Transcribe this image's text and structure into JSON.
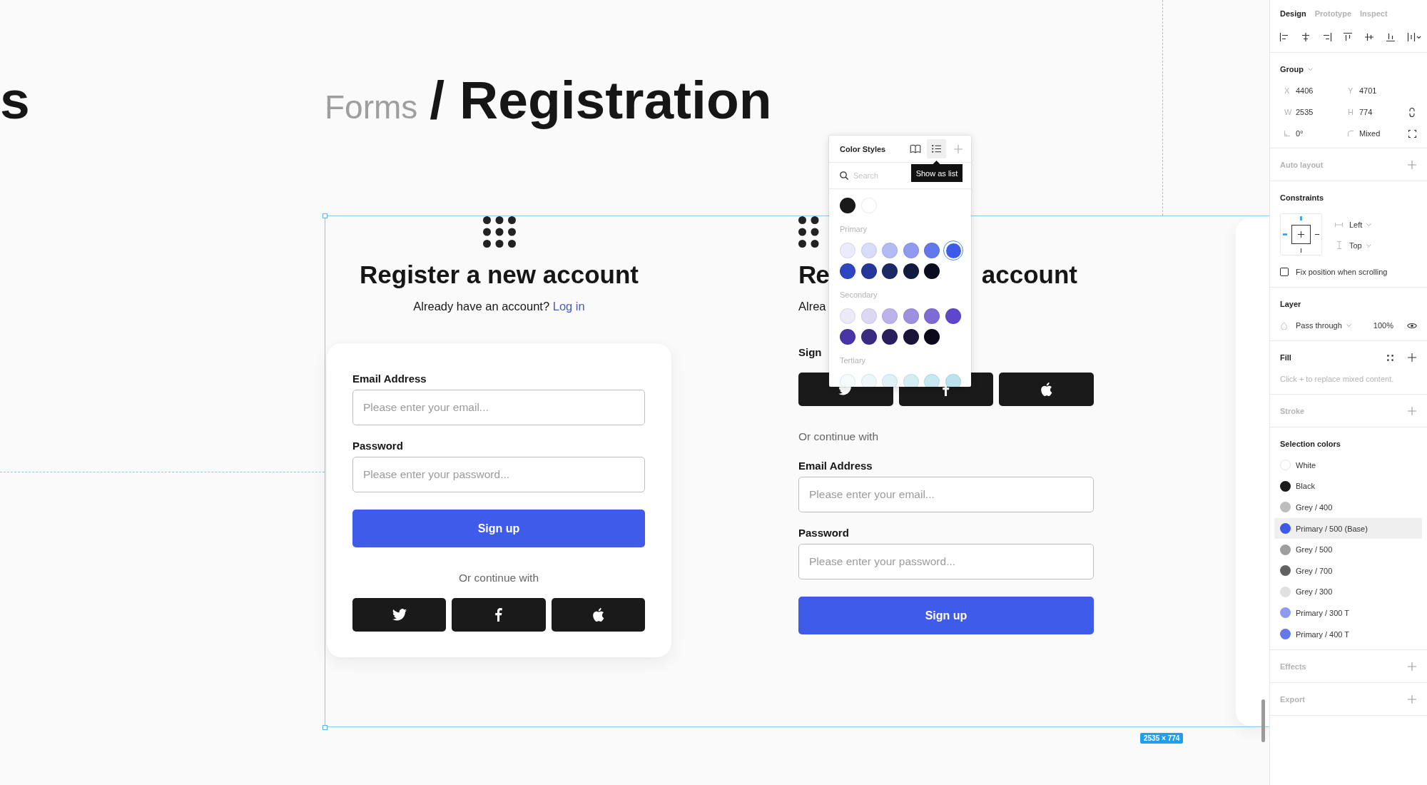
{
  "canvas": {
    "edge_title": "s",
    "breadcrumb": "Forms",
    "title": "/ Registration",
    "frames": [
      {
        "kind": "full",
        "heading": "Register a new account",
        "prompt": "Already have an account?",
        "link": "Log in",
        "fields": [
          {
            "label": "Email Address",
            "placeholder": "Please enter your email..."
          },
          {
            "label": "Password",
            "placeholder": "Please enter your password..."
          }
        ],
        "submit": "Sign up",
        "continue_text": "Or continue with",
        "social": [
          {
            "kind": "twitter"
          },
          {
            "kind": "facebook"
          },
          {
            "kind": "apple"
          }
        ]
      },
      {
        "kind": "covered",
        "heading_start": "Re",
        "heading_end": "account",
        "prompt": "Alrea",
        "social_label": "Sign",
        "social": [
          {
            "kind": "twitter"
          },
          {
            "kind": "facebook"
          },
          {
            "kind": "apple"
          }
        ],
        "continue_text": "Or continue with",
        "fields": [
          {
            "label": "Email Address",
            "placeholder": "Please enter your email..."
          },
          {
            "label": "Password",
            "placeholder": "Please enter your password..."
          }
        ],
        "submit": "Sign up"
      }
    ],
    "size_badge": "2535 × 774"
  },
  "color_styles": {
    "title": "Color Styles",
    "tools": [
      {
        "kind": "book",
        "selected": false
      },
      {
        "kind": "list",
        "selected": true
      },
      {
        "kind": "add",
        "selected": false
      }
    ],
    "tooltip": "Show as list",
    "search_placeholder": "Search",
    "groups": [
      {
        "swatches": [
          {
            "color": "#1a1a1a",
            "selected": false
          },
          {
            "color": "#ffffff",
            "selected": false
          }
        ]
      },
      {
        "label": "Primary",
        "swatches": [
          {
            "color": "#ebebfb",
            "selected": false
          },
          {
            "color": "#d8dcf9",
            "selected": false
          },
          {
            "color": "#b3bbf5",
            "selected": false
          },
          {
            "color": "#8f9bf0",
            "selected": false
          },
          {
            "color": "#6478ec",
            "selected": false
          },
          {
            "color": "#3d5ae8",
            "selected": true
          },
          {
            "color": "#2e46c2",
            "selected": false
          },
          {
            "color": "#253799",
            "selected": false
          },
          {
            "color": "#1b2866",
            "selected": false
          },
          {
            "color": "#121a40",
            "selected": false
          },
          {
            "color": "#0a0d1f",
            "selected": false
          }
        ]
      },
      {
        "label": "Secondary",
        "swatches": [
          {
            "color": "#eceaf8",
            "selected": false
          },
          {
            "color": "#dcd7f3",
            "selected": false
          },
          {
            "color": "#bdb3ea",
            "selected": false
          },
          {
            "color": "#9e8fe0",
            "selected": false
          },
          {
            "color": "#7f6bd6",
            "selected": false
          },
          {
            "color": "#5f47cc",
            "selected": false
          },
          {
            "color": "#4a35a8",
            "selected": false
          },
          {
            "color": "#3b2a82",
            "selected": false
          },
          {
            "color": "#2a1f5b",
            "selected": false
          },
          {
            "color": "#1a1437",
            "selected": false
          },
          {
            "color": "#0b0919",
            "selected": false
          }
        ]
      },
      {
        "label": "Tertiary",
        "swatches": [
          {
            "color": "#f5fbfc",
            "selected": false
          },
          {
            "color": "#edf7f9",
            "selected": false
          },
          {
            "color": "#def1f5",
            "selected": false
          },
          {
            "color": "#d3edf3",
            "selected": false
          },
          {
            "color": "#c7e8f1",
            "selected": false
          },
          {
            "color": "#bae3ee",
            "selected": false
          }
        ]
      }
    ]
  },
  "panel": {
    "tabs": [
      {
        "label": "Design",
        "selected": true
      },
      {
        "label": "Prototype",
        "selected": false
      },
      {
        "label": "Inspect",
        "selected": false
      }
    ],
    "sections": [
      {
        "kind": "properties",
        "title": "Group",
        "rows": [
          [
            {
              "kind": "axis",
              "label": "X",
              "value": "4406"
            },
            {
              "kind": "axis",
              "label": "Y",
              "value": "4701"
            }
          ],
          [
            {
              "kind": "axis",
              "label": "W",
              "value": "2535"
            },
            {
              "kind": "axis",
              "label": "H",
              "value": "774"
            }
          ],
          [
            {
              "kind": "rotation",
              "value": "0°"
            },
            {
              "kind": "radius",
              "value": "Mixed"
            }
          ]
        ]
      },
      {
        "kind": "empty",
        "title": "Auto layout"
      },
      {
        "kind": "constraints",
        "title": "Constraints",
        "horizontal": "Left",
        "vertical": "Top",
        "fix_position": {
          "label": "Fix position when scrolling",
          "checked": false
        }
      },
      {
        "kind": "layer",
        "title": "Layer",
        "blend": "Pass through",
        "opacity": "100%"
      },
      {
        "kind": "fill",
        "title": "Fill",
        "note": "Click + to replace mixed content."
      },
      {
        "kind": "empty",
        "title": "Stroke"
      },
      {
        "kind": "selection_colors",
        "title": "Selection colors",
        "items": [
          {
            "name": "White",
            "color": "#ffffff",
            "selected": false
          },
          {
            "name": "Black",
            "color": "#1a1a1a",
            "selected": false
          },
          {
            "name": "Grey / 400",
            "color": "#bdbdbd",
            "selected": false
          },
          {
            "name": "Primary / 500 (Base)",
            "color": "#3d5ae8",
            "selected": true
          },
          {
            "name": "Grey / 500",
            "color": "#9e9e9e",
            "selected": false
          },
          {
            "name": "Grey / 700",
            "color": "#616161",
            "selected": false
          },
          {
            "name": "Grey / 300",
            "color": "#e0e0e0",
            "selected": false
          },
          {
            "name": "Primary / 300 T",
            "color": "#8f9bf0",
            "selected": false
          },
          {
            "name": "Primary / 400 T",
            "color": "#6478ec",
            "selected": false
          }
        ]
      },
      {
        "kind": "empty",
        "title": "Effects"
      },
      {
        "kind": "empty",
        "title": "Export"
      }
    ]
  }
}
